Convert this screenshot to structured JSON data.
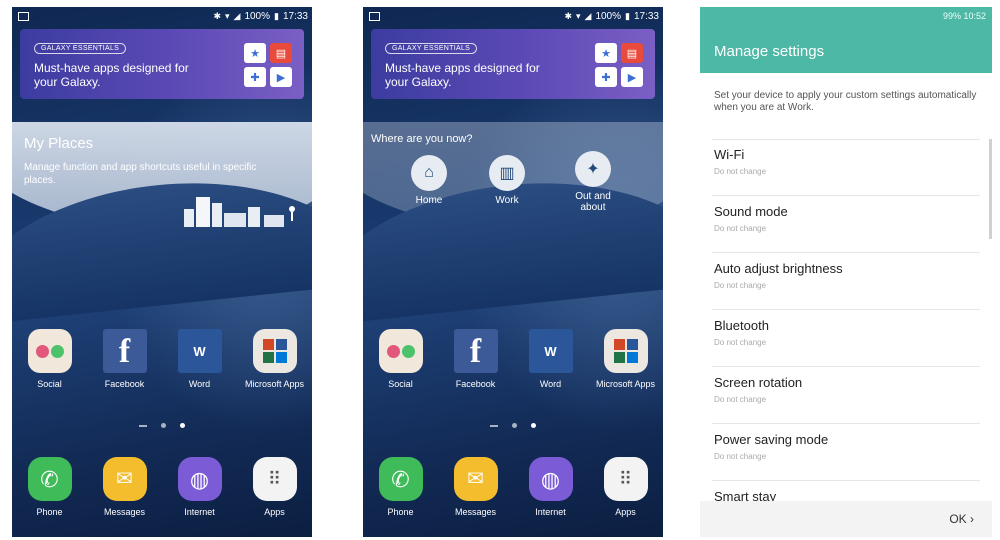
{
  "phone1": {
    "status_time": "17:33",
    "status_battery": "100%",
    "galaxy": {
      "badge": "GALAXY ESSENTIALS",
      "message": "Must-have apps designed for your Galaxy."
    },
    "my_places": {
      "title": "My Places",
      "description": "Manage function and app shortcuts useful in specific places."
    },
    "apps": [
      {
        "label": "Social"
      },
      {
        "label": "Facebook"
      },
      {
        "label": "Word"
      },
      {
        "label": "Microsoft Apps"
      }
    ],
    "dock": [
      {
        "label": "Phone"
      },
      {
        "label": "Messages"
      },
      {
        "label": "Internet"
      },
      {
        "label": "Apps"
      }
    ]
  },
  "phone2": {
    "status_time": "17:33",
    "status_battery": "100%",
    "galaxy": {
      "badge": "GALAXY ESSENTIALS",
      "message": "Must-have apps designed for your Galaxy."
    },
    "where": {
      "title": "Where are you now?",
      "items": [
        {
          "label": "Home"
        },
        {
          "label": "Work"
        },
        {
          "label": "Out and about"
        }
      ]
    },
    "apps": [
      {
        "label": "Social"
      },
      {
        "label": "Facebook"
      },
      {
        "label": "Word"
      },
      {
        "label": "Microsoft Apps"
      }
    ],
    "dock": [
      {
        "label": "Phone"
      },
      {
        "label": "Messages"
      },
      {
        "label": "Internet"
      },
      {
        "label": "Apps"
      }
    ]
  },
  "settings": {
    "status": "99% 10:52",
    "title": "Manage settings",
    "description": "Set your device to apply your custom settings automatically when you are at Work.",
    "items": [
      {
        "title": "Wi-Fi",
        "value": "Do not change"
      },
      {
        "title": "Sound mode",
        "value": "Do not change"
      },
      {
        "title": "Auto adjust brightness",
        "value": "Do not change"
      },
      {
        "title": "Bluetooth",
        "value": "Do not change"
      },
      {
        "title": "Screen rotation",
        "value": "Do not change"
      },
      {
        "title": "Power saving mode",
        "value": "Do not change"
      },
      {
        "title": "Smart stay",
        "value": ""
      }
    ],
    "ok_label": "OK"
  },
  "colors": {
    "accent_teal": "#4db8a5",
    "galaxy_purple": "#5c4ab5"
  }
}
